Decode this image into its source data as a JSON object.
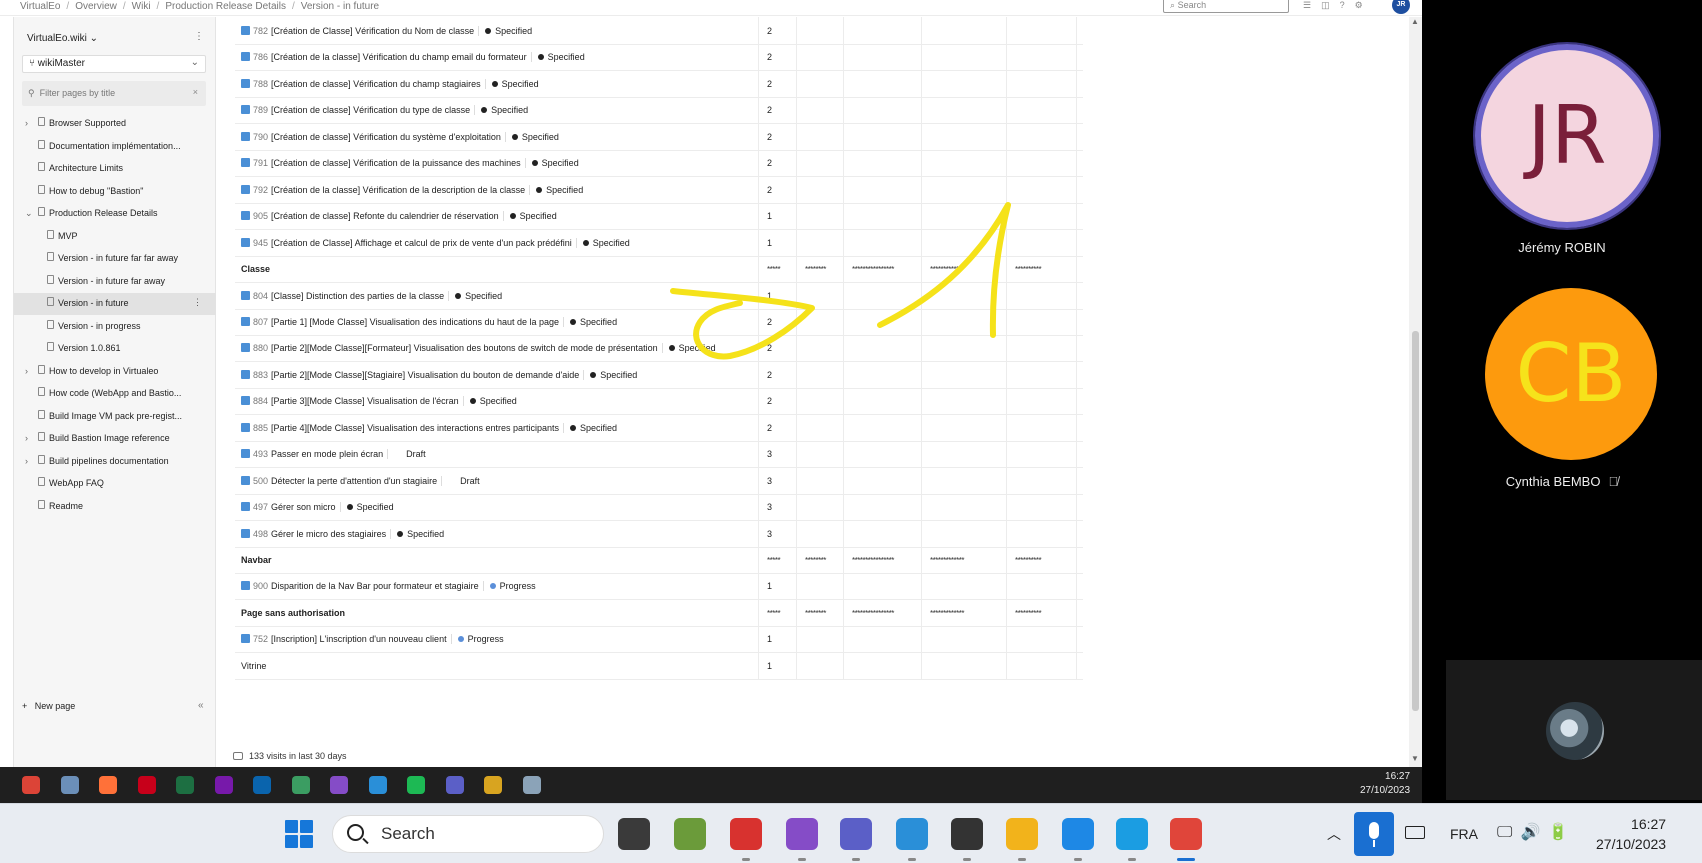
{
  "breadcrumb": [
    "VirtualEo",
    "Overview",
    "Wiki",
    "Production Release Details",
    "Version - in future"
  ],
  "top_search": {
    "placeholder": "Search"
  },
  "user_initials": "JR",
  "sidebar": {
    "wiki_name": "VirtualEo.wiki",
    "branch": "wikiMaster",
    "filter_placeholder": "Filter pages by title",
    "items": [
      {
        "label": "Browser Supported",
        "level": 0,
        "expander": "collapsed"
      },
      {
        "label": "Documentation implémentation...",
        "level": 0,
        "expander": "none"
      },
      {
        "label": "Architecture Limits",
        "level": 0,
        "expander": "none"
      },
      {
        "label": "How to debug \"Bastion\"",
        "level": 0,
        "expander": "none"
      },
      {
        "label": "Production Release Details",
        "level": 0,
        "expander": "expanded"
      },
      {
        "label": "MVP",
        "level": 1,
        "expander": "none"
      },
      {
        "label": "Version - in future far far away",
        "level": 1,
        "expander": "none"
      },
      {
        "label": "Version - in future far away",
        "level": 1,
        "expander": "none"
      },
      {
        "label": "Version - in future",
        "level": 1,
        "expander": "none",
        "selected": true
      },
      {
        "label": "Version - in progress",
        "level": 1,
        "expander": "none"
      },
      {
        "label": "Version 1.0.861",
        "level": 1,
        "expander": "none"
      },
      {
        "label": "How to develop in Virtualeo",
        "level": 0,
        "expander": "collapsed"
      },
      {
        "label": "How code (WebApp and Bastio...",
        "level": 0,
        "expander": "none"
      },
      {
        "label": "Build Image VM pack pre-regist...",
        "level": 0,
        "expander": "none"
      },
      {
        "label": "Build Bastion Image reference",
        "level": 0,
        "expander": "collapsed"
      },
      {
        "label": "Build pipelines documentation",
        "level": 0,
        "expander": "collapsed"
      },
      {
        "label": "WebApp FAQ",
        "level": 0,
        "expander": "none"
      },
      {
        "label": "Readme",
        "level": 0,
        "expander": "none"
      }
    ],
    "new_page": "New page",
    "collapse_icon": "double-chevron-left-icon"
  },
  "table": {
    "rows": [
      {
        "kind": "item",
        "id": "782",
        "title": "[Création de Classe] Vérification du Nom de classe",
        "state": "Specified",
        "state_dot": "black",
        "value": "2"
      },
      {
        "kind": "item",
        "id": "786",
        "title": "[Création de la classe] Vérification du champ email du formateur",
        "state": "Specified",
        "state_dot": "black",
        "value": "2"
      },
      {
        "kind": "item",
        "id": "788",
        "title": "[Création de classe] Vérification du champ stagiaires",
        "state": "Specified",
        "state_dot": "black",
        "value": "2"
      },
      {
        "kind": "item",
        "id": "789",
        "title": "[Création de classe] Vérification du type de classe",
        "state": "Specified",
        "state_dot": "black",
        "value": "2"
      },
      {
        "kind": "item",
        "id": "790",
        "title": "[Création de classe] Vérification du système d'exploitation",
        "state": "Specified",
        "state_dot": "black",
        "value": "2"
      },
      {
        "kind": "item",
        "id": "791",
        "title": "[Création de classe] Vérification de la puissance des machines",
        "state": "Specified",
        "state_dot": "black",
        "value": "2"
      },
      {
        "kind": "item",
        "id": "792",
        "title": "[Création de la classe] Vérification de la description de la classe",
        "state": "Specified",
        "state_dot": "black",
        "value": "2"
      },
      {
        "kind": "item",
        "id": "905",
        "title": "[Création de classe] Refonte du calendrier de réservation",
        "state": "Specified",
        "state_dot": "black",
        "value": "1"
      },
      {
        "kind": "item",
        "id": "945",
        "title": "[Création de Classe] Affichage et calcul de prix de vente d'un pack prédéfini",
        "state": "Specified",
        "state_dot": "black",
        "value": "1"
      },
      {
        "kind": "group",
        "label": "Classe",
        "stars": [
          "*****",
          "********",
          "****************",
          "*************",
          "**********"
        ]
      },
      {
        "kind": "item",
        "id": "804",
        "title": "[Classe] Distinction des parties de la classe",
        "state": "Specified",
        "state_dot": "black",
        "value": "1"
      },
      {
        "kind": "item",
        "id": "807",
        "title": "[Partie 1] [Mode Classe] Visualisation des indications du haut de la page",
        "state": "Specified",
        "state_dot": "black",
        "value": "2"
      },
      {
        "kind": "item",
        "id": "880",
        "title": "[Partie 2][Mode Classe][Formateur] Visualisation des boutons de switch de mode de présentation",
        "state": "Specified",
        "state_dot": "black",
        "value": "2"
      },
      {
        "kind": "item",
        "id": "883",
        "title": "[Partie 2][Mode Classe][Stagiaire] Visualisation du bouton de demande d'aide",
        "state": "Specified",
        "state_dot": "black",
        "value": "2"
      },
      {
        "kind": "item",
        "id": "884",
        "title": "[Partie 3][Mode Classe] Visualisation de l'écran",
        "state": "Specified",
        "state_dot": "black",
        "value": "2"
      },
      {
        "kind": "item",
        "id": "885",
        "title": "[Partie 4][Mode Classe] Visualisation des interactions entres participants",
        "state": "Specified",
        "state_dot": "black",
        "value": "2"
      },
      {
        "kind": "item",
        "id": "493",
        "title": "Passer en mode plein écran",
        "state": "Draft",
        "state_dot": "none",
        "value": "3"
      },
      {
        "kind": "item",
        "id": "500",
        "title": "Détecter la perte d'attention d'un stagiaire",
        "state": "Draft",
        "state_dot": "none",
        "value": "3"
      },
      {
        "kind": "item",
        "id": "497",
        "title": "Gérer son micro",
        "state": "Specified",
        "state_dot": "black",
        "value": "3"
      },
      {
        "kind": "item",
        "id": "498",
        "title": "Gérer le micro des stagiaires",
        "state": "Specified",
        "state_dot": "black",
        "value": "3"
      },
      {
        "kind": "group",
        "label": "Navbar",
        "stars": [
          "*****",
          "********",
          "****************",
          "*************",
          "**********"
        ]
      },
      {
        "kind": "item",
        "id": "900",
        "title": "Disparition de la Nav Bar pour formateur et stagiaire",
        "state": "Progress",
        "state_dot": "blue",
        "value": "1"
      },
      {
        "kind": "group",
        "label": "Page sans authorisation",
        "stars": [
          "*****",
          "********",
          "****************",
          "*************",
          "**********"
        ]
      },
      {
        "kind": "item",
        "id": "752",
        "title": "[Inscription] L'inscription d'un nouveau client",
        "state": "Progress",
        "state_dot": "blue",
        "value": "1"
      },
      {
        "kind": "plain",
        "label": "Vitrine",
        "value": "1"
      }
    ]
  },
  "visits": "133 visits in last 30 days",
  "inner_clock": {
    "time": "16:27",
    "date": "27/10/2023"
  },
  "inner_taskbar_icons": [
    {
      "name": "chrome-icon",
      "color": "#dc4437"
    },
    {
      "name": "browser-globe-icon",
      "color": "#6b8fb8"
    },
    {
      "name": "firefox-icon",
      "color": "#ff7139"
    },
    {
      "name": "opera-icon",
      "color": "#c7001a"
    },
    {
      "name": "excel-icon",
      "color": "#1d6f42"
    },
    {
      "name": "onenote-icon",
      "color": "#7719aa"
    },
    {
      "name": "outlook-icon",
      "color": "#0a64ad"
    },
    {
      "name": "file-tool-icon",
      "color": "#3b9d62"
    },
    {
      "name": "visual-studio-icon",
      "color": "#854cc7"
    },
    {
      "name": "vscode-icon",
      "color": "#2a8fd8"
    },
    {
      "name": "spotify-icon",
      "color": "#1db954"
    },
    {
      "name": "teams-icon",
      "color": "#5b5fc7"
    },
    {
      "name": "app-tool-icon",
      "color": "#d8a420"
    },
    {
      "name": "network-tool-icon",
      "color": "#8ba3b8"
    }
  ],
  "meeting": {
    "participants": [
      {
        "initials": "JR",
        "name": "Jérémy ROBIN"
      },
      {
        "initials": "CB",
        "name": "Cynthia BEMBO",
        "muted": true
      }
    ]
  },
  "taskbar": {
    "search_label": "Search",
    "apps": [
      {
        "name": "task-view-icon",
        "color": "#3a3a3a"
      },
      {
        "name": "image-viewer-icon",
        "color": "#6b9b3a"
      },
      {
        "name": "xmind-icon",
        "color": "#d8322f"
      },
      {
        "name": "visual-studio-icon",
        "color": "#854cc7"
      },
      {
        "name": "teams-icon",
        "color": "#5b5fc7"
      },
      {
        "name": "vscode-icon",
        "color": "#2a8fd8"
      },
      {
        "name": "terminal-icon",
        "color": "#333333"
      },
      {
        "name": "file-explorer-icon",
        "color": "#f2b31b"
      },
      {
        "name": "power-automate-icon",
        "color": "#1e88e5"
      },
      {
        "name": "edge-icon",
        "color": "#1b9de2"
      },
      {
        "name": "snipping-tool-icon",
        "color": "#e0453a"
      }
    ],
    "lang": "FRA",
    "time": "16:27",
    "date": "27/10/2023"
  },
  "colors": {
    "accent": "#1677d9",
    "ink": "#f5e21a",
    "jr_avatar_bg": "#f4d5df",
    "cb_avatar_bg": "#fd9a0d"
  }
}
